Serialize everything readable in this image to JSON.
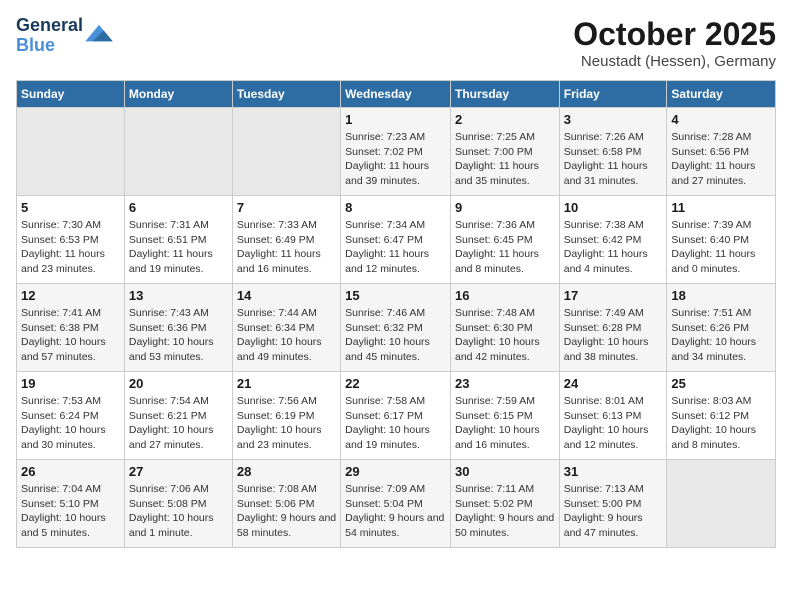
{
  "logo": {
    "line1": "General",
    "line2": "Blue"
  },
  "title": "October 2025",
  "location": "Neustadt (Hessen), Germany",
  "weekdays": [
    "Sunday",
    "Monday",
    "Tuesday",
    "Wednesday",
    "Thursday",
    "Friday",
    "Saturday"
  ],
  "weeks": [
    [
      {
        "day": "",
        "info": ""
      },
      {
        "day": "",
        "info": ""
      },
      {
        "day": "",
        "info": ""
      },
      {
        "day": "1",
        "info": "Sunrise: 7:23 AM\nSunset: 7:02 PM\nDaylight: 11 hours and 39 minutes."
      },
      {
        "day": "2",
        "info": "Sunrise: 7:25 AM\nSunset: 7:00 PM\nDaylight: 11 hours and 35 minutes."
      },
      {
        "day": "3",
        "info": "Sunrise: 7:26 AM\nSunset: 6:58 PM\nDaylight: 11 hours and 31 minutes."
      },
      {
        "day": "4",
        "info": "Sunrise: 7:28 AM\nSunset: 6:56 PM\nDaylight: 11 hours and 27 minutes."
      }
    ],
    [
      {
        "day": "5",
        "info": "Sunrise: 7:30 AM\nSunset: 6:53 PM\nDaylight: 11 hours and 23 minutes."
      },
      {
        "day": "6",
        "info": "Sunrise: 7:31 AM\nSunset: 6:51 PM\nDaylight: 11 hours and 19 minutes."
      },
      {
        "day": "7",
        "info": "Sunrise: 7:33 AM\nSunset: 6:49 PM\nDaylight: 11 hours and 16 minutes."
      },
      {
        "day": "8",
        "info": "Sunrise: 7:34 AM\nSunset: 6:47 PM\nDaylight: 11 hours and 12 minutes."
      },
      {
        "day": "9",
        "info": "Sunrise: 7:36 AM\nSunset: 6:45 PM\nDaylight: 11 hours and 8 minutes."
      },
      {
        "day": "10",
        "info": "Sunrise: 7:38 AM\nSunset: 6:42 PM\nDaylight: 11 hours and 4 minutes."
      },
      {
        "day": "11",
        "info": "Sunrise: 7:39 AM\nSunset: 6:40 PM\nDaylight: 11 hours and 0 minutes."
      }
    ],
    [
      {
        "day": "12",
        "info": "Sunrise: 7:41 AM\nSunset: 6:38 PM\nDaylight: 10 hours and 57 minutes."
      },
      {
        "day": "13",
        "info": "Sunrise: 7:43 AM\nSunset: 6:36 PM\nDaylight: 10 hours and 53 minutes."
      },
      {
        "day": "14",
        "info": "Sunrise: 7:44 AM\nSunset: 6:34 PM\nDaylight: 10 hours and 49 minutes."
      },
      {
        "day": "15",
        "info": "Sunrise: 7:46 AM\nSunset: 6:32 PM\nDaylight: 10 hours and 45 minutes."
      },
      {
        "day": "16",
        "info": "Sunrise: 7:48 AM\nSunset: 6:30 PM\nDaylight: 10 hours and 42 minutes."
      },
      {
        "day": "17",
        "info": "Sunrise: 7:49 AM\nSunset: 6:28 PM\nDaylight: 10 hours and 38 minutes."
      },
      {
        "day": "18",
        "info": "Sunrise: 7:51 AM\nSunset: 6:26 PM\nDaylight: 10 hours and 34 minutes."
      }
    ],
    [
      {
        "day": "19",
        "info": "Sunrise: 7:53 AM\nSunset: 6:24 PM\nDaylight: 10 hours and 30 minutes."
      },
      {
        "day": "20",
        "info": "Sunrise: 7:54 AM\nSunset: 6:21 PM\nDaylight: 10 hours and 27 minutes."
      },
      {
        "day": "21",
        "info": "Sunrise: 7:56 AM\nSunset: 6:19 PM\nDaylight: 10 hours and 23 minutes."
      },
      {
        "day": "22",
        "info": "Sunrise: 7:58 AM\nSunset: 6:17 PM\nDaylight: 10 hours and 19 minutes."
      },
      {
        "day": "23",
        "info": "Sunrise: 7:59 AM\nSunset: 6:15 PM\nDaylight: 10 hours and 16 minutes."
      },
      {
        "day": "24",
        "info": "Sunrise: 8:01 AM\nSunset: 6:13 PM\nDaylight: 10 hours and 12 minutes."
      },
      {
        "day": "25",
        "info": "Sunrise: 8:03 AM\nSunset: 6:12 PM\nDaylight: 10 hours and 8 minutes."
      }
    ],
    [
      {
        "day": "26",
        "info": "Sunrise: 7:04 AM\nSunset: 5:10 PM\nDaylight: 10 hours and 5 minutes."
      },
      {
        "day": "27",
        "info": "Sunrise: 7:06 AM\nSunset: 5:08 PM\nDaylight: 10 hours and 1 minute."
      },
      {
        "day": "28",
        "info": "Sunrise: 7:08 AM\nSunset: 5:06 PM\nDaylight: 9 hours and 58 minutes."
      },
      {
        "day": "29",
        "info": "Sunrise: 7:09 AM\nSunset: 5:04 PM\nDaylight: 9 hours and 54 minutes."
      },
      {
        "day": "30",
        "info": "Sunrise: 7:11 AM\nSunset: 5:02 PM\nDaylight: 9 hours and 50 minutes."
      },
      {
        "day": "31",
        "info": "Sunrise: 7:13 AM\nSunset: 5:00 PM\nDaylight: 9 hours and 47 minutes."
      },
      {
        "day": "",
        "info": ""
      }
    ]
  ]
}
